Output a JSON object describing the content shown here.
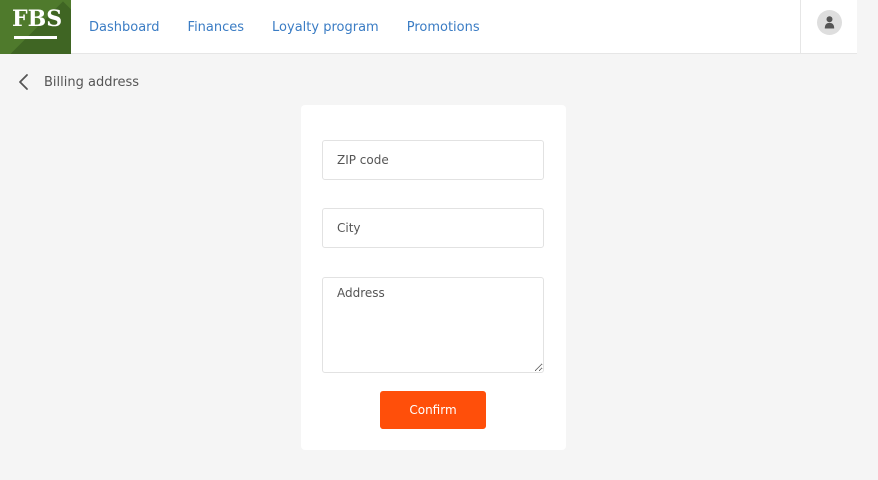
{
  "brand": {
    "logo_text": "FBS",
    "color": "#4f7a2c"
  },
  "nav": {
    "items": [
      {
        "label": "Dashboard"
      },
      {
        "label": "Finances"
      },
      {
        "label": "Loyalty program"
      },
      {
        "label": "Promotions"
      }
    ]
  },
  "user": {
    "icon": "user-icon"
  },
  "page": {
    "back_icon": "chevron-left-icon",
    "title": "Billing address"
  },
  "form": {
    "zip_placeholder": "ZIP code",
    "city_placeholder": "City",
    "address_placeholder": "Address",
    "confirm_label": "Confirm",
    "accent_color": "#ff4f0a"
  }
}
